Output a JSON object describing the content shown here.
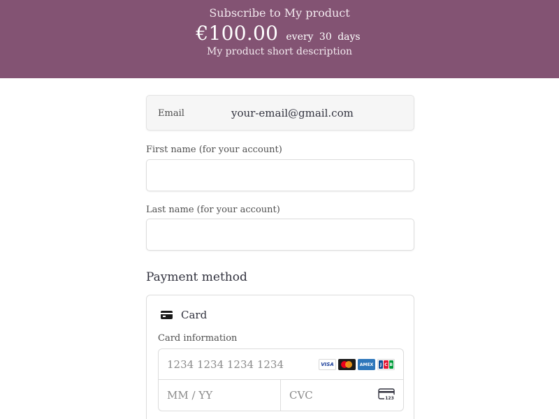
{
  "header": {
    "subscribe_text": "Subscribe to My product",
    "price": "€100.00",
    "interval_every": "every",
    "interval_count": "30",
    "interval_unit": "days",
    "description": "My product short description",
    "background_color": "#835373"
  },
  "email": {
    "label": "Email",
    "value": "your-email@gmail.com"
  },
  "first_name": {
    "label": "First name (for your account)",
    "value": ""
  },
  "last_name": {
    "label": "Last name (for your account)",
    "value": ""
  },
  "payment": {
    "section_title": "Payment method",
    "method_tab_label": "Card",
    "method_tab_icon": "credit-card-icon",
    "card_info_label": "Card information",
    "card_number_placeholder": "1234 1234 1234 1234",
    "expiry_placeholder": "MM / YY",
    "cvc_placeholder": "CVC",
    "brand_icons": [
      "visa-icon",
      "mastercard-icon",
      "amex-icon",
      "jcb-icon"
    ],
    "cvc_icon": "card-cvc-icon",
    "brand_visa_text": "VISA",
    "brand_amex_text": "AMEX",
    "brand_jcb_letters": [
      "J",
      "C",
      "B"
    ],
    "cvc_icon_text": "123"
  }
}
